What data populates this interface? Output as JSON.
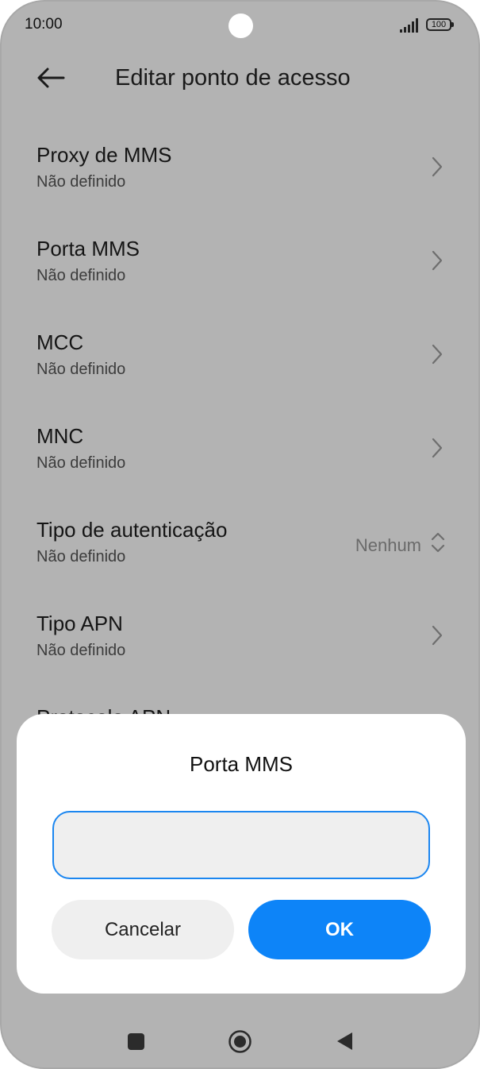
{
  "status_bar": {
    "time": "10:00",
    "battery": "100",
    "signal_icon": "signal-bars-icon",
    "battery_icon": "battery-icon"
  },
  "header": {
    "title": "Editar ponto de acesso",
    "back_icon": "arrow-left-icon"
  },
  "settings": [
    {
      "label": "Proxy de MMS",
      "value": "Não definido"
    },
    {
      "label": "Porta MMS",
      "value": "Não definido"
    },
    {
      "label": "MCC",
      "value": "Não definido"
    },
    {
      "label": "MNC",
      "value": "Não definido"
    },
    {
      "label": "Tipo de autenticação",
      "value": "Não definido",
      "selected": "Nenhum"
    },
    {
      "label": "Tipo APN",
      "value": "Não definido"
    },
    {
      "label": "Protocolo APN"
    }
  ],
  "dialog": {
    "title": "Porta MMS",
    "input_value": "",
    "cancel_label": "Cancelar",
    "ok_label": "OK"
  },
  "colors": {
    "accent": "#0d84f8",
    "input_border": "#1b86f0",
    "scrim_background": "#b3b3b3"
  }
}
